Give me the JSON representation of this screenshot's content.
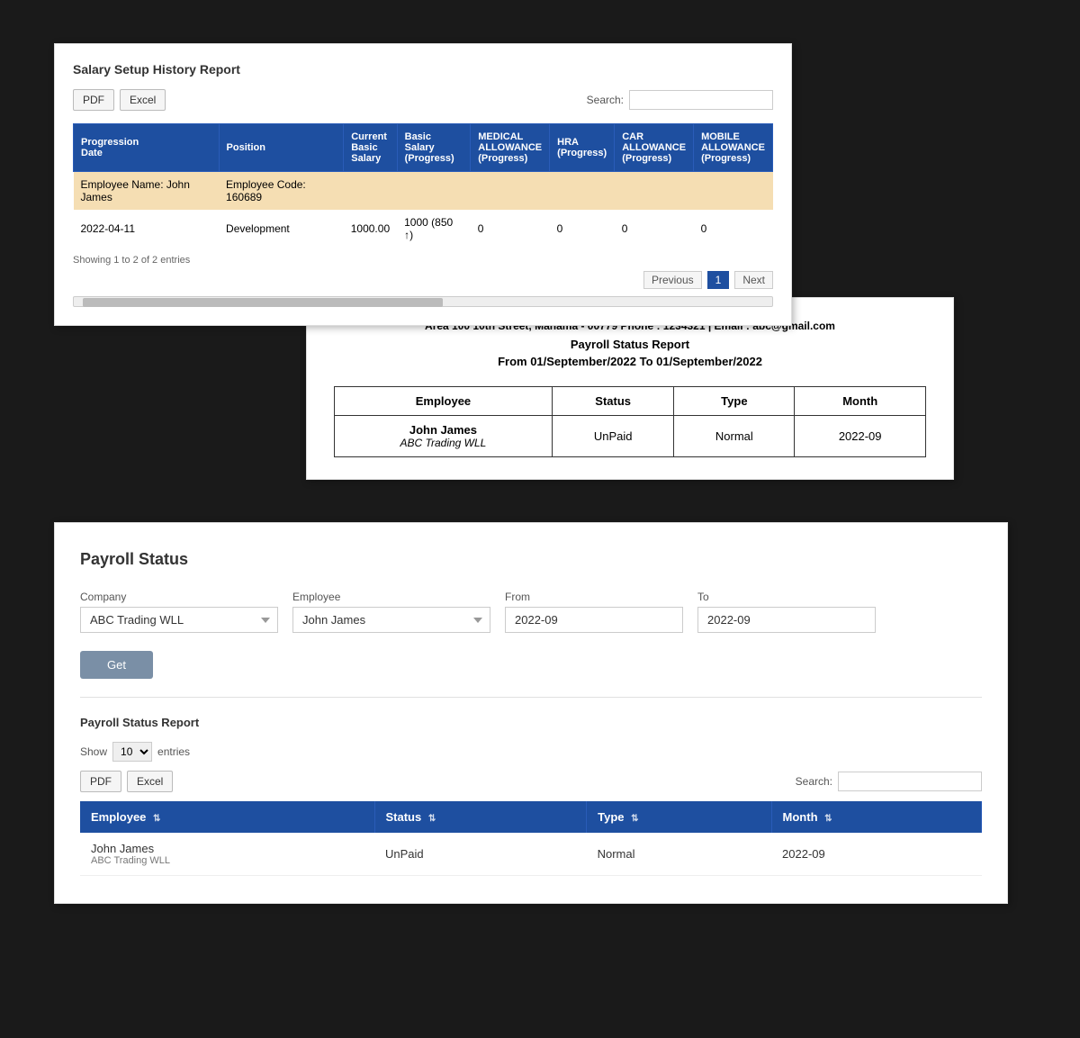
{
  "panel1": {
    "title": "Salary Setup History Report",
    "pdf_btn": "PDF",
    "excel_btn": "Excel",
    "search_label": "Search:",
    "columns": [
      "Progression Date",
      "Position",
      "Current Basic Salary",
      "Basic Salary (Progress)",
      "MEDICAL ALLOWANCE (Progress)",
      "HRA (Progress)",
      "CAR ALLOWANCE (Progress)",
      "MOBILE ALLOWANCE (Progress)"
    ],
    "employee_row": {
      "name": "Employee Name: John James",
      "code": "Employee Code: 160689"
    },
    "data_row": {
      "date": "2022-04-11",
      "position": "Development",
      "current_basic": "1000.00",
      "basic_progress": "1000 (850 ↑)",
      "medical": "0",
      "hra": "0",
      "car": "0",
      "mobile": "0"
    },
    "showing_text": "Showing 1 to 2 of 2 entries",
    "prev_btn": "Previous",
    "page_num": "1",
    "next_btn": "Next"
  },
  "panel2": {
    "address": "Area 100 10th Street, Manama - 00779 Phone : 1234321 | Email : abc@gmail.com",
    "report_title": "Payroll Status Report",
    "date_range": "From 01/September/2022 To 01/September/2022",
    "columns": [
      "Employee",
      "Status",
      "Type",
      "Month"
    ],
    "rows": [
      {
        "employee_name": "John James",
        "employee_company": "ABC Trading WLL",
        "status": "UnPaid",
        "type": "Normal",
        "month": "2022-09"
      }
    ]
  },
  "panel3": {
    "title": "Payroll Status",
    "company_label": "Company",
    "company_value": "ABC Trading WLL",
    "employee_label": "Employee",
    "employee_value": "John James",
    "from_label": "From",
    "from_value": "2022-09",
    "to_label": "To",
    "to_value": "2022-09",
    "get_btn": "Get",
    "sub_title": "Payroll Status Report",
    "show_label": "Show",
    "show_value": "10",
    "entries_label": "entries",
    "pdf_btn": "PDF",
    "excel_btn": "Excel",
    "search_label": "Search:",
    "columns": [
      "Employee",
      "Status",
      "Type",
      "Month"
    ],
    "rows": [
      {
        "employee_name": "John James",
        "employee_company": "ABC Trading WLL",
        "status": "UnPaid",
        "type": "Normal",
        "month": "2022-09"
      }
    ]
  }
}
